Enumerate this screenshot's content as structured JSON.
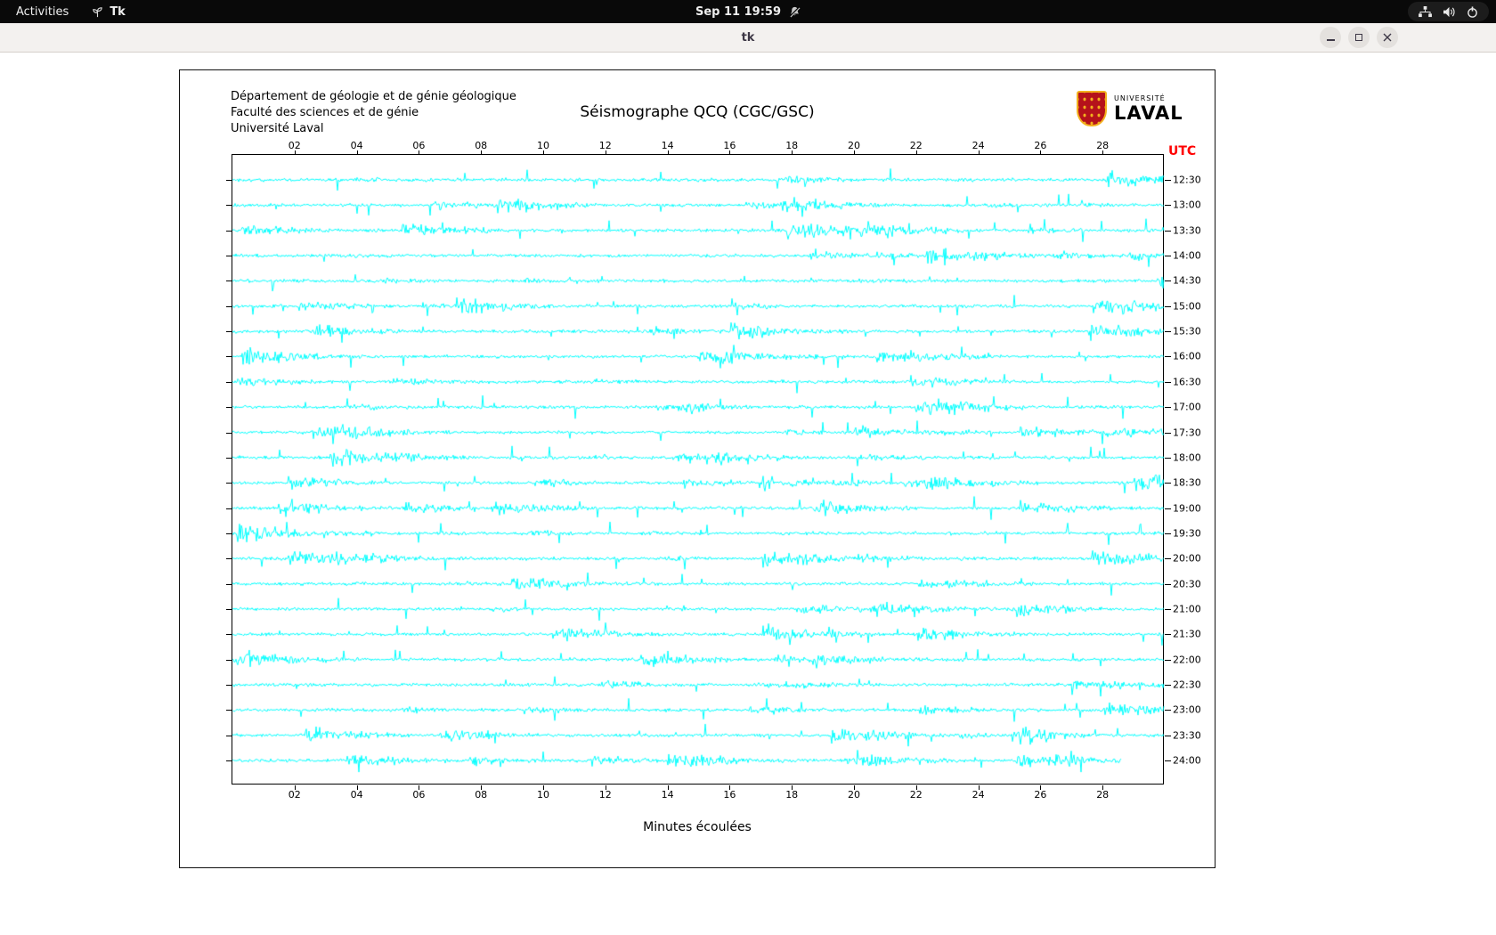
{
  "topbar": {
    "activities_label": "Activities",
    "app_label": "Tk",
    "clock_text": "Sep 11 19:59"
  },
  "window": {
    "title": "tk"
  },
  "header": {
    "lines": [
      "Département de géologie et de génie géologique",
      "Faculté des sciences et de génie",
      "Université Laval"
    ]
  },
  "logo": {
    "small_text": "UNIVERSITÉ",
    "large_text": "LAVAL",
    "shield_color": "#b5121b",
    "accent_color": "#f2b01e"
  },
  "chart_data": {
    "type": "line",
    "title": "Séismographe QCQ (CGC/GSC)",
    "utc_label": "UTC",
    "utc_color": "#ff0000",
    "xlabel": "Minutes écoulées",
    "x_ticks": [
      "02",
      "04",
      "06",
      "08",
      "10",
      "12",
      "14",
      "16",
      "18",
      "20",
      "22",
      "24",
      "26",
      "28"
    ],
    "x_range": [
      0,
      30
    ],
    "trace_color": "#00ffff",
    "rows": [
      "12:30",
      "13:00",
      "13:30",
      "14:00",
      "14:30",
      "15:00",
      "15:30",
      "16:00",
      "16:30",
      "17:00",
      "17:30",
      "18:00",
      "18:30",
      "19:00",
      "19:30",
      "20:00",
      "20:30",
      "21:00",
      "21:30",
      "22:00",
      "22:30",
      "23:00",
      "23:30",
      "24:00"
    ],
    "last_row_fraction": 0.954
  }
}
